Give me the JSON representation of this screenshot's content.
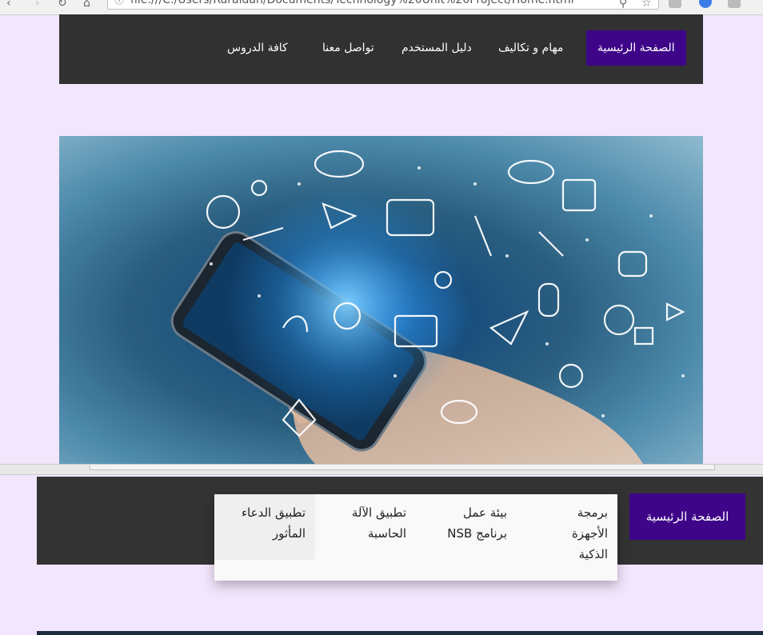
{
  "browser": {
    "url": "file:///C:/Users/Ruraldan/Documents/Technology%20Unit%20Project/Home.html"
  },
  "top_nav": {
    "items": [
      {
        "label": "الصفحة الرئيسية",
        "active": true
      },
      {
        "label": "مهام و تكاليف"
      },
      {
        "label": "دليل المستخدم"
      },
      {
        "label": "تواصل معنا"
      },
      {
        "label": "كافة الدروس"
      }
    ]
  },
  "second_nav": {
    "active_label": "الصفحة الرئيسية",
    "dropdown": [
      {
        "label": "برمجة الأجهزة الذكية"
      },
      {
        "label": "بيئة عمل برنامج NSB"
      },
      {
        "label": "تطبيق الآلة الحاسبة"
      },
      {
        "label": "تطبيق الدعاء المأثور",
        "hover": true
      }
    ]
  },
  "colors": {
    "page_bg": "#f2e6fd",
    "nav_bg": "#313131",
    "accent": "#3e0589"
  }
}
